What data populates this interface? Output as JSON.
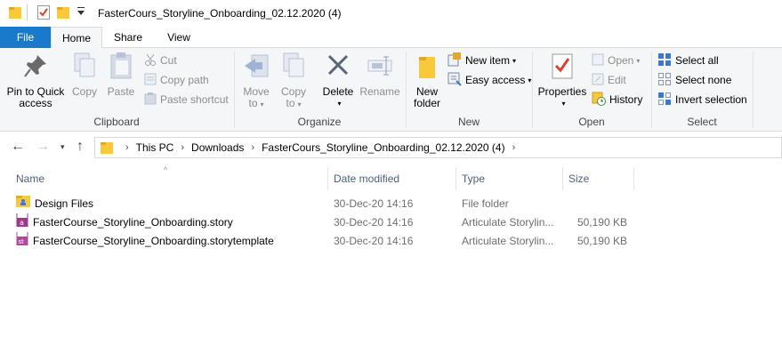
{
  "window": {
    "title": "FasterCours_Storyline_Onboarding_02.12.2020 (4)"
  },
  "tabs": [
    {
      "label": "File"
    },
    {
      "label": "Home"
    },
    {
      "label": "Share"
    },
    {
      "label": "View"
    }
  ],
  "ribbon": {
    "clipboard": {
      "label": "Clipboard",
      "pin_line1": "Pin to Quick",
      "pin_line2": "access",
      "copy": "Copy",
      "paste": "Paste",
      "cut": "Cut",
      "copy_path": "Copy path",
      "paste_shortcut": "Paste shortcut"
    },
    "organize": {
      "label": "Organize",
      "move_to_1": "Move",
      "move_to_2": "to",
      "copy_to_1": "Copy",
      "copy_to_2": "to",
      "delete": "Delete",
      "rename": "Rename"
    },
    "new": {
      "label": "New",
      "new_folder_1": "New",
      "new_folder_2": "folder",
      "new_item": "New item",
      "easy_access": "Easy access"
    },
    "open": {
      "label": "Open",
      "properties": "Properties",
      "open": "Open",
      "edit": "Edit",
      "history": "History"
    },
    "select": {
      "label": "Select",
      "select_all": "Select all",
      "select_none": "Select none",
      "invert_selection": "Invert selection"
    }
  },
  "address": {
    "crumbs": [
      "This PC",
      "Downloads",
      "FasterCours_Storyline_Onboarding_02.12.2020 (4)"
    ]
  },
  "columns": {
    "name": "Name",
    "date": "Date modified",
    "type": "Type",
    "size": "Size"
  },
  "files": [
    {
      "name": "Design Files",
      "date": "30-Dec-20 14:16",
      "type": "File folder",
      "size": "",
      "icon": "folder-icon"
    },
    {
      "name": "FasterCourse_Storyline_Onboarding.story",
      "date": "30-Dec-20 14:16",
      "type": "Articulate Storylin...",
      "size": "50,190 KB",
      "icon": "story-file-icon"
    },
    {
      "name": "FasterCourse_Storyline_Onboarding.storytemplate",
      "date": "30-Dec-20 14:16",
      "type": "Articulate Storylin...",
      "size": "50,190 KB",
      "icon": "storytemplate-file-icon"
    }
  ],
  "colors": {
    "accent": "#1979ca",
    "folder": "#f8c93c",
    "header_text": "#4c607a"
  }
}
